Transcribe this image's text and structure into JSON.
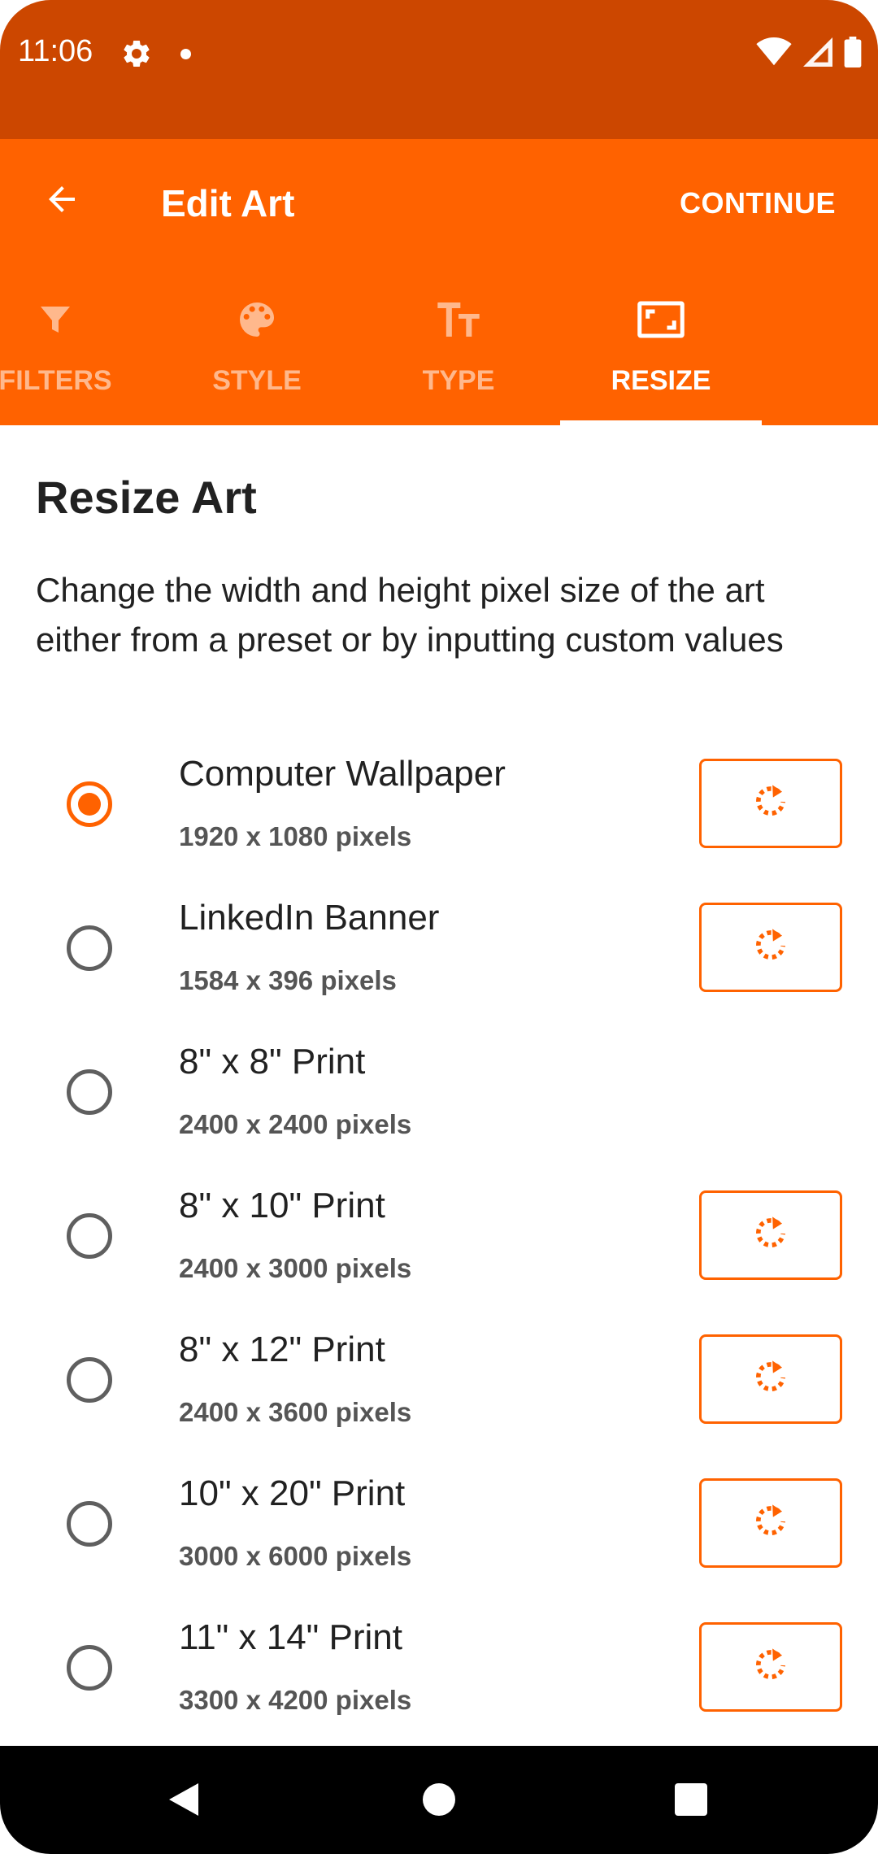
{
  "status_bar": {
    "time": "11:06",
    "icons": [
      "gear-icon",
      "notification-dot-icon",
      "wifi-icon",
      "signal-icon",
      "battery-icon"
    ]
  },
  "app_bar": {
    "title": "Edit Art",
    "continue_label": "CONTINUE",
    "back_icon": "arrow-back-icon"
  },
  "tabs": [
    {
      "label": "FILTERS",
      "icon": "filter-icon",
      "active": false
    },
    {
      "label": "STYLE",
      "icon": "palette-icon",
      "active": false
    },
    {
      "label": "TYPE",
      "icon": "text-type-icon",
      "active": false
    },
    {
      "label": "RESIZE",
      "icon": "aspect-ratio-icon",
      "active": true
    }
  ],
  "content": {
    "title": "Resize Art",
    "description": "Change the width and height pixel size of the art either from a preset or by inputting custom values"
  },
  "options": [
    {
      "name": "Computer Wallpaper",
      "size": "1920 x 1080 pixels",
      "selected": true,
      "has_reset": true
    },
    {
      "name": "LinkedIn Banner",
      "size": "1584 x 396 pixels",
      "selected": false,
      "has_reset": true
    },
    {
      "name": "8\" x 8\" Print",
      "size": "2400 x 2400 pixels",
      "selected": false,
      "has_reset": false
    },
    {
      "name": "8\" x 10\" Print",
      "size": "2400 x 3000 pixels",
      "selected": false,
      "has_reset": true
    },
    {
      "name": "8\" x 12\" Print",
      "size": "2400 x 3600 pixels",
      "selected": false,
      "has_reset": true
    },
    {
      "name": "10\" x 20\" Print",
      "size": "3000 x 6000 pixels",
      "selected": false,
      "has_reset": true
    },
    {
      "name": "11\" x 14\" Print",
      "size": "3300 x 4200 pixels",
      "selected": false,
      "has_reset": true
    }
  ],
  "colors": {
    "status_bar": "#cc4700",
    "app_bar": "#ff6200",
    "accent": "#ff6200",
    "nav_bar": "#000000"
  },
  "nav_bar": {
    "icons": [
      "nav-back-icon",
      "nav-home-icon",
      "nav-recents-icon"
    ]
  }
}
